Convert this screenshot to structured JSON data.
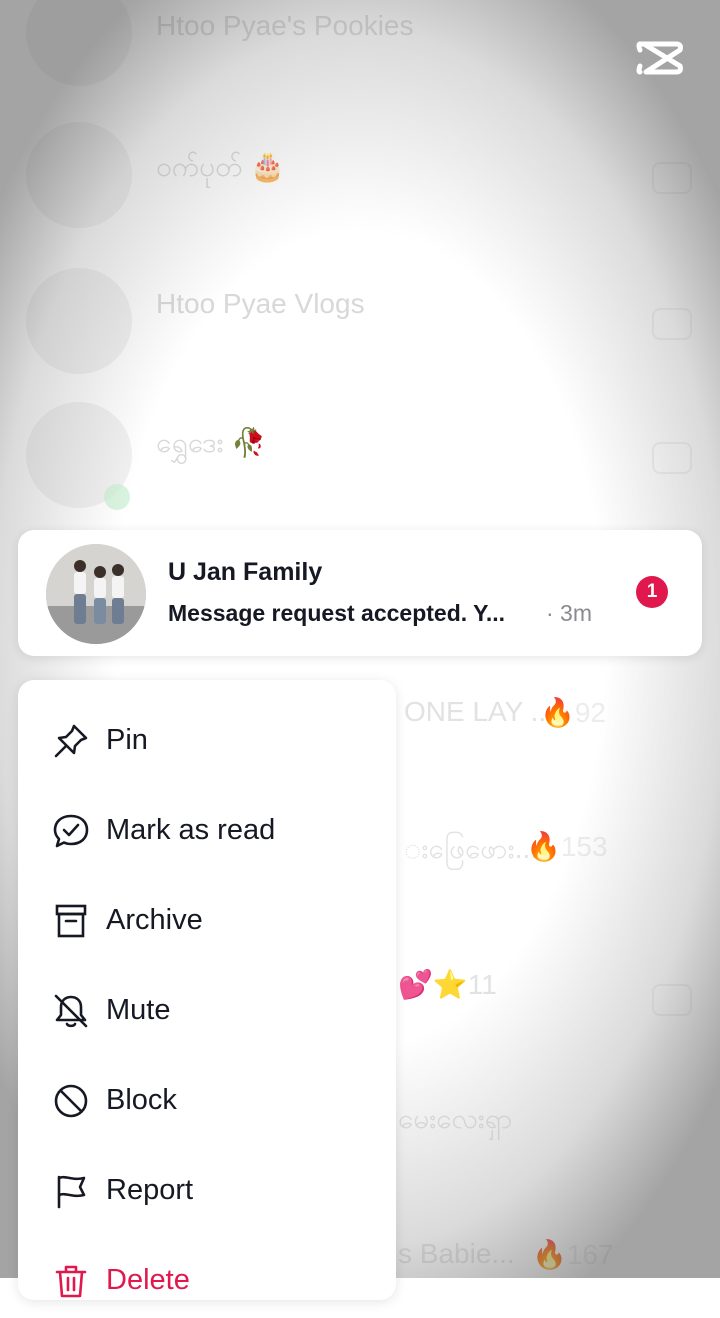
{
  "background_chats": [
    {
      "name": "Htoo Pyae's Pookies",
      "top": 0
    },
    {
      "name": "ဝက်ပုတ် 🎂",
      "top": 0
    },
    {
      "name": "Htoo Pyae Vlogs",
      "top": 0
    },
    {
      "name": "ရွှေဒေး 🥀",
      "top": 0
    }
  ],
  "background_fragments": {
    "row5_text": "ONE LAY ..",
    "row5_count": "🔥92",
    "row6_text": "းဖြေဖေား...",
    "row6_count": "🔥153",
    "row7_text": "💕⭐11",
    "row8_text": "မေးလေးရှာ",
    "row9_text": "s Babie...",
    "row9_count": "🔥167"
  },
  "selected_chat": {
    "name": "U Jan Family",
    "last_message": "Message request accepted. Y...",
    "time": "· 3m",
    "unread_count": "1"
  },
  "menu": {
    "items": [
      {
        "label": "Pin",
        "icon": "pin-icon"
      },
      {
        "label": "Mark as read",
        "icon": "mark-read-icon"
      },
      {
        "label": "Archive",
        "icon": "archive-icon"
      },
      {
        "label": "Mute",
        "icon": "mute-bell-icon"
      },
      {
        "label": "Block",
        "icon": "block-icon"
      },
      {
        "label": "Report",
        "icon": "flag-icon"
      },
      {
        "label": "Delete",
        "icon": "trash-icon"
      }
    ]
  },
  "colors": {
    "accent": "#e0184d",
    "text": "#161823",
    "muted": "#8a8b91"
  }
}
